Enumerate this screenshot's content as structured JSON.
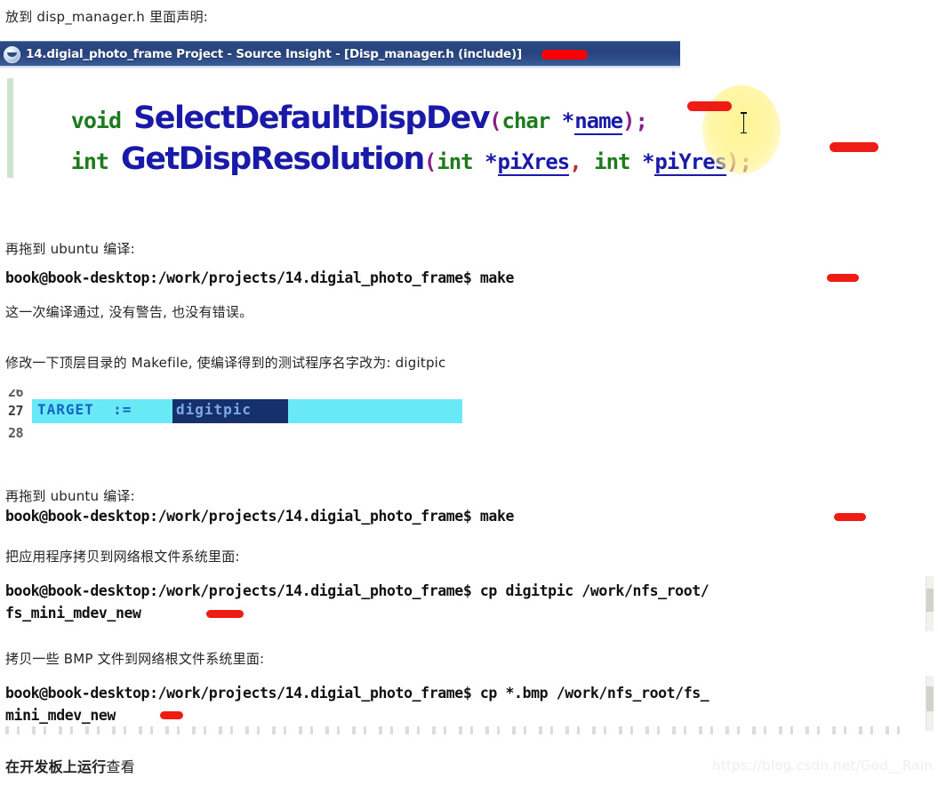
{
  "doc": {
    "watermark": "https://blog.csdn.net/God__Rain"
  },
  "intro": {
    "line1": "放到 disp_manager.h 里面声明:"
  },
  "source_insight": {
    "icon": "source-insight-app-icon",
    "title": "14.digial_photo_frame Project - Source Insight - [Disp_manager.h (include)]",
    "title_accent": "#ffffff",
    "titlebar_color": "#2b4a86",
    "annotation_color": "#fb0005",
    "code": {
      "line1": {
        "keyword": "void",
        "function": "SelectDefaultDispDev",
        "open_paren": "(",
        "param_type": "char",
        "param_star": "*",
        "param_name": "name",
        "close_paren": ")",
        "semicolon": ";"
      },
      "line2": {
        "keyword": "int",
        "function": "GetDispResolution",
        "open_paren": "(",
        "param1_type": "int",
        "param1_star": "*",
        "param1_name": "piXres",
        "comma": ",",
        "param2_type": "int",
        "param2_star": "*",
        "param2_name": "piYres",
        "close_paren": ")",
        "semicolon": ";"
      },
      "colors": {
        "keyword": "#1d7a1d",
        "function": "#1a1aa8",
        "punctuation": "#8a1f8a",
        "variable": "#1a1aa8",
        "left_margin_bar": "#cfe4cf"
      }
    }
  },
  "section_compile_1": {
    "caption": "再拖到 ubuntu 编译:",
    "terminal": "book@book-desktop:/work/projects/14.digial_photo_frame$ make",
    "result": "这一次编译通过, 没有警告, 也没有错误。"
  },
  "section_makefile": {
    "caption": "修改一下顶层目录的 Makefile, 使编译得到的测试程序名字改为: digitpic",
    "editor": {
      "line_number_above": "26",
      "line_number": "27",
      "line_number_below": "28",
      "code_prefix": "TARGET  := ",
      "selected_text": "digitpic",
      "highlight_color": "#69e8f5",
      "selection_color": "#16306b",
      "code_color": "#1464c8"
    }
  },
  "section_compile_2": {
    "caption": "再拖到 ubuntu 编译:",
    "terminal": "book@book-desktop:/work/projects/14.digial_photo_frame$ make"
  },
  "section_copy_app": {
    "caption": "把应用程序拷贝到网络根文件系统里面:",
    "terminal_line1": "book@book-desktop:/work/projects/14.digial_photo_frame$ cp digitpic /work/nfs_root/",
    "terminal_line2": "fs_mini_mdev_new"
  },
  "section_copy_bmp": {
    "caption": "拷贝一些 BMP 文件到网络根文件系统里面:",
    "terminal_line1": "book@book-desktop:/work/projects/14.digial_photo_frame$ cp *.bmp /work/nfs_root/fs_",
    "terminal_line2": "mini_mdev_new"
  },
  "footer": {
    "heading_bold": "在开发板上运行",
    "heading_rest": "查看"
  }
}
